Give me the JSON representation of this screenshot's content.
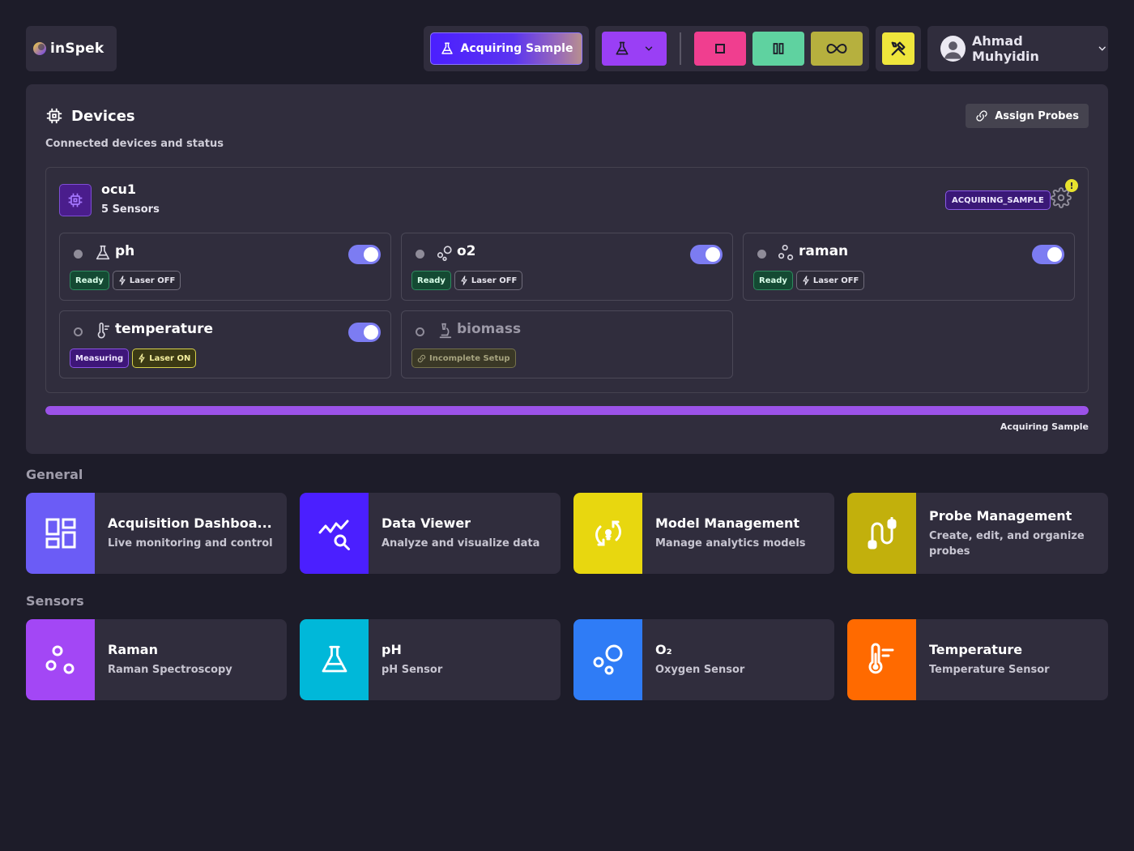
{
  "app": {
    "logo_text": "inSpek"
  },
  "header": {
    "acquire_label": "Acquiring Sample",
    "user_name": "Ahmad Muhyidin"
  },
  "devices_panel": {
    "title": "Devices",
    "subtitle": "Connected devices and status",
    "assign_label": "Assign Probes",
    "device": {
      "name": "ocu1",
      "sensor_count": "5 Sensors",
      "state": "ACQUIRING_SAMPLE",
      "alert": "!",
      "sensors": [
        {
          "name": "ph",
          "icon": "flask-icon",
          "status": "Ready",
          "laser": "Laser OFF",
          "enabled": true
        },
        {
          "name": "o2",
          "icon": "bubbles-icon",
          "status": "Ready",
          "laser": "Laser OFF",
          "enabled": true
        },
        {
          "name": "raman",
          "icon": "molecule-icon",
          "status": "Ready",
          "laser": "Laser OFF",
          "enabled": true
        },
        {
          "name": "temperature",
          "icon": "thermometer-icon",
          "status": "Measuring",
          "laser": "Laser ON",
          "enabled": true
        },
        {
          "name": "biomass",
          "icon": "microscope-icon",
          "status": "Incomplete Setup",
          "enabled": false
        }
      ]
    },
    "progress": {
      "percent": 100,
      "label": "Acquiring Sample"
    }
  },
  "general": {
    "title": "General",
    "tiles": [
      {
        "title": "Acquisition Dashboa...",
        "desc": "Live monitoring and control",
        "color": "#6b5cf6",
        "icon": "dashboard-icon"
      },
      {
        "title": "Data Viewer",
        "desc": "Analyze and visualize data",
        "color": "#4b1fff",
        "icon": "chart-search-icon"
      },
      {
        "title": "Model Management",
        "desc": "Manage analytics models",
        "color": "#e8d70f",
        "icon": "model-refresh-icon"
      },
      {
        "title": "Probe Management",
        "desc": "Create, edit, and organize probes",
        "color": "#c2b00c",
        "icon": "probe-icon"
      }
    ]
  },
  "sensors": {
    "title": "Sensors",
    "tiles": [
      {
        "title": "Raman",
        "desc": "Raman Spectroscopy",
        "color": "#a347f5",
        "icon": "molecule-icon"
      },
      {
        "title": "pH",
        "desc": "pH Sensor",
        "color": "#00b8d9",
        "icon": "flask-icon"
      },
      {
        "title": "O₂",
        "desc": "Oxygen Sensor",
        "color": "#2f7cf6",
        "icon": "bubbles-icon"
      },
      {
        "title": "Temperature",
        "desc": "Temperature Sensor",
        "color": "#ff6a00",
        "icon": "thermometer-icon"
      }
    ]
  }
}
